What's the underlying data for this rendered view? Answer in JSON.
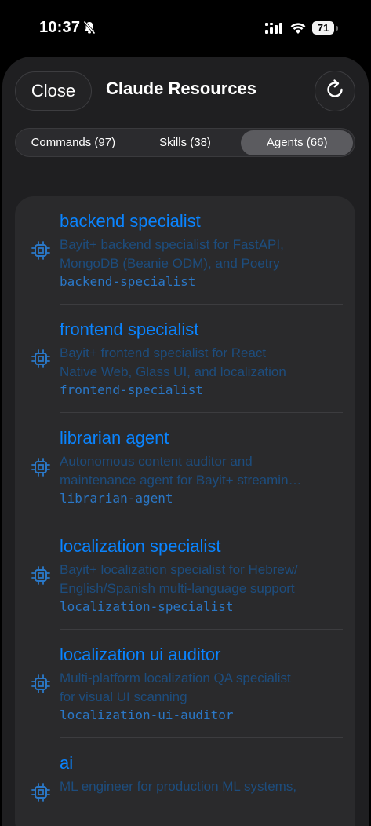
{
  "status": {
    "time": "10:37",
    "battery": "71"
  },
  "header": {
    "close_label": "Close",
    "title": "Claude Resources"
  },
  "tabs": [
    {
      "label": "Commands (97)",
      "active": false
    },
    {
      "label": "Skills (38)",
      "active": false
    },
    {
      "label": "Agents (66)",
      "active": true
    }
  ],
  "agents": [
    {
      "name": "backend specialist",
      "desc1": "Bayit+ backend specialist for FastAPI,",
      "desc2": "MongoDB (Beanie ODM), and Poetry",
      "id": "backend-specialist"
    },
    {
      "name": "frontend specialist",
      "desc1": "Bayit+ frontend specialist for React",
      "desc2": "Native Web, Glass UI, and localization",
      "id": "frontend-specialist"
    },
    {
      "name": "librarian agent",
      "desc1": "Autonomous content auditor and",
      "desc2": "maintenance agent for Bayit+ streamin…",
      "id": "librarian-agent"
    },
    {
      "name": "localization specialist",
      "desc1": "Bayit+ localization specialist for Hebrew/",
      "desc2": "English/Spanish multi-language support",
      "id": "localization-specialist"
    },
    {
      "name": "localization ui auditor",
      "desc1": "Multi-platform localization QA specialist",
      "desc2": "for visual UI scanning",
      "id": "localization-ui-auditor"
    },
    {
      "name": "ai",
      "desc1": "ML engineer for production ML systems,",
      "desc2": "",
      "id": ""
    }
  ],
  "colors": {
    "accent": "#0a84ff",
    "description": "#1d4d7e",
    "identifier": "#2a78c8",
    "card": "#2a2a2c",
    "sheet": "#1f1f21"
  },
  "icons": {
    "status_bell": "bell-slash-icon",
    "status_signal": "cellular-signal-icon",
    "status_wifi": "wifi-icon",
    "refresh": "refresh-icon",
    "agent": "cpu-chip-icon"
  }
}
